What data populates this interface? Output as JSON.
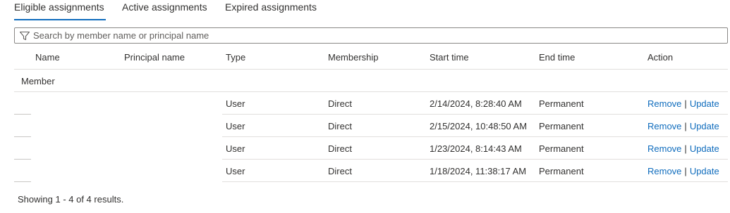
{
  "tabs": [
    {
      "label": "Eligible assignments",
      "active": true
    },
    {
      "label": "Active assignments",
      "active": false
    },
    {
      "label": "Expired assignments",
      "active": false
    }
  ],
  "search": {
    "placeholder": "Search by member name or principal name",
    "value": ""
  },
  "columns": [
    "Name",
    "Principal name",
    "Type",
    "Membership",
    "Start time",
    "End time",
    "Action"
  ],
  "group_label": "Member",
  "rows": [
    {
      "name": "",
      "principal": "",
      "type": "User",
      "membership": "Direct",
      "start": "2/14/2024, 8:28:40 AM",
      "end": "Permanent",
      "remove": "Remove",
      "separator": "|",
      "update": "Update"
    },
    {
      "name": "",
      "principal": "",
      "type": "User",
      "membership": "Direct",
      "start": "2/15/2024, 10:48:50 AM",
      "end": "Permanent",
      "remove": "Remove",
      "separator": "|",
      "update": "Update"
    },
    {
      "name": "",
      "principal": "",
      "type": "User",
      "membership": "Direct",
      "start": "1/23/2024, 8:14:43 AM",
      "end": "Permanent",
      "remove": "Remove",
      "separator": "|",
      "update": "Update"
    },
    {
      "name": "",
      "principal": "",
      "type": "User",
      "membership": "Direct",
      "start": "1/18/2024, 11:38:17 AM",
      "end": "Permanent",
      "remove": "Remove",
      "separator": "|",
      "update": "Update"
    }
  ],
  "footer": "Showing 1 - 4 of 4 results.",
  "colors": {
    "accent": "#0f6cbd",
    "border": "#e1dfdd",
    "text": "#323130"
  },
  "icons": {
    "search": "filter-funnel-icon"
  }
}
